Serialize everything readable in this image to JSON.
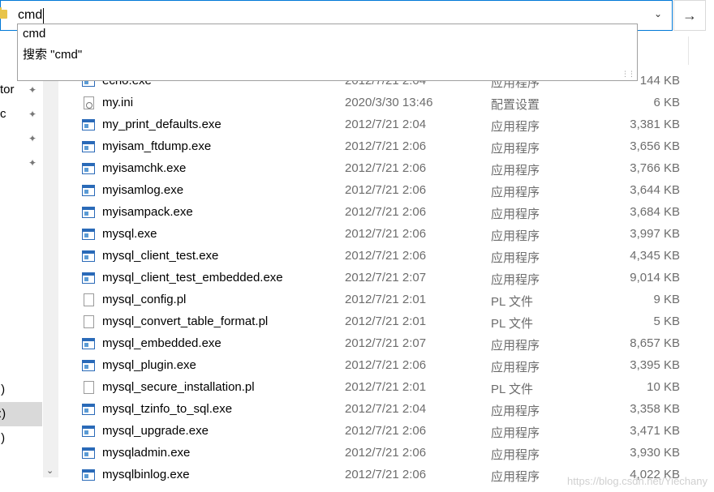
{
  "address_bar": {
    "value": "cmd",
    "go_icon": "arrow-right-icon",
    "dropdown_icon": "chevron-down-icon"
  },
  "autocomplete": {
    "items": [
      "cmd",
      "搜索 \"cmd\""
    ]
  },
  "nav": {
    "items": [
      {
        "label": "tor",
        "pinned": true
      },
      {
        "label": "c",
        "pinned": true
      },
      {
        "label": "",
        "pinned": true
      },
      {
        "label": "",
        "pinned": true
      },
      {
        "label": ":)",
        "pinned": false
      },
      {
        "label": "):)",
        "pinned": false,
        "selected": true
      },
      {
        "label": ":)",
        "pinned": false
      }
    ]
  },
  "files": [
    {
      "name": "echo.exe",
      "date": "2012/7/21 2:04",
      "type": "应用程序",
      "size": "144 KB",
      "icon": "exe"
    },
    {
      "name": "my.ini",
      "date": "2020/3/30 13:46",
      "type": "配置设置",
      "size": "6 KB",
      "icon": "ini"
    },
    {
      "name": "my_print_defaults.exe",
      "date": "2012/7/21 2:04",
      "type": "应用程序",
      "size": "3,381 KB",
      "icon": "exe"
    },
    {
      "name": "myisam_ftdump.exe",
      "date": "2012/7/21 2:06",
      "type": "应用程序",
      "size": "3,656 KB",
      "icon": "exe"
    },
    {
      "name": "myisamchk.exe",
      "date": "2012/7/21 2:06",
      "type": "应用程序",
      "size": "3,766 KB",
      "icon": "exe"
    },
    {
      "name": "myisamlog.exe",
      "date": "2012/7/21 2:06",
      "type": "应用程序",
      "size": "3,644 KB",
      "icon": "exe"
    },
    {
      "name": "myisampack.exe",
      "date": "2012/7/21 2:06",
      "type": "应用程序",
      "size": "3,684 KB",
      "icon": "exe"
    },
    {
      "name": "mysql.exe",
      "date": "2012/7/21 2:06",
      "type": "应用程序",
      "size": "3,997 KB",
      "icon": "exe"
    },
    {
      "name": "mysql_client_test.exe",
      "date": "2012/7/21 2:06",
      "type": "应用程序",
      "size": "4,345 KB",
      "icon": "exe"
    },
    {
      "name": "mysql_client_test_embedded.exe",
      "date": "2012/7/21 2:07",
      "type": "应用程序",
      "size": "9,014 KB",
      "icon": "exe"
    },
    {
      "name": "mysql_config.pl",
      "date": "2012/7/21 2:01",
      "type": "PL 文件",
      "size": "9 KB",
      "icon": "pl"
    },
    {
      "name": "mysql_convert_table_format.pl",
      "date": "2012/7/21 2:01",
      "type": "PL 文件",
      "size": "5 KB",
      "icon": "pl"
    },
    {
      "name": "mysql_embedded.exe",
      "date": "2012/7/21 2:07",
      "type": "应用程序",
      "size": "8,657 KB",
      "icon": "exe"
    },
    {
      "name": "mysql_plugin.exe",
      "date": "2012/7/21 2:06",
      "type": "应用程序",
      "size": "3,395 KB",
      "icon": "exe"
    },
    {
      "name": "mysql_secure_installation.pl",
      "date": "2012/7/21 2:01",
      "type": "PL 文件",
      "size": "10 KB",
      "icon": "pl"
    },
    {
      "name": "mysql_tzinfo_to_sql.exe",
      "date": "2012/7/21 2:04",
      "type": "应用程序",
      "size": "3,358 KB",
      "icon": "exe"
    },
    {
      "name": "mysql_upgrade.exe",
      "date": "2012/7/21 2:06",
      "type": "应用程序",
      "size": "3,471 KB",
      "icon": "exe"
    },
    {
      "name": "mysqladmin.exe",
      "date": "2012/7/21 2:06",
      "type": "应用程序",
      "size": "3,930 KB",
      "icon": "exe"
    },
    {
      "name": "mysqlbinlog.exe",
      "date": "2012/7/21 2:06",
      "type": "应用程序",
      "size": "4,022 KB",
      "icon": "exe"
    }
  ],
  "watermark": "https://blog.csdn.net/Yiechany",
  "colors": {
    "accent": "#0078d7",
    "selection": "#d9d9d9",
    "muted_text": "#6d6d6d"
  }
}
